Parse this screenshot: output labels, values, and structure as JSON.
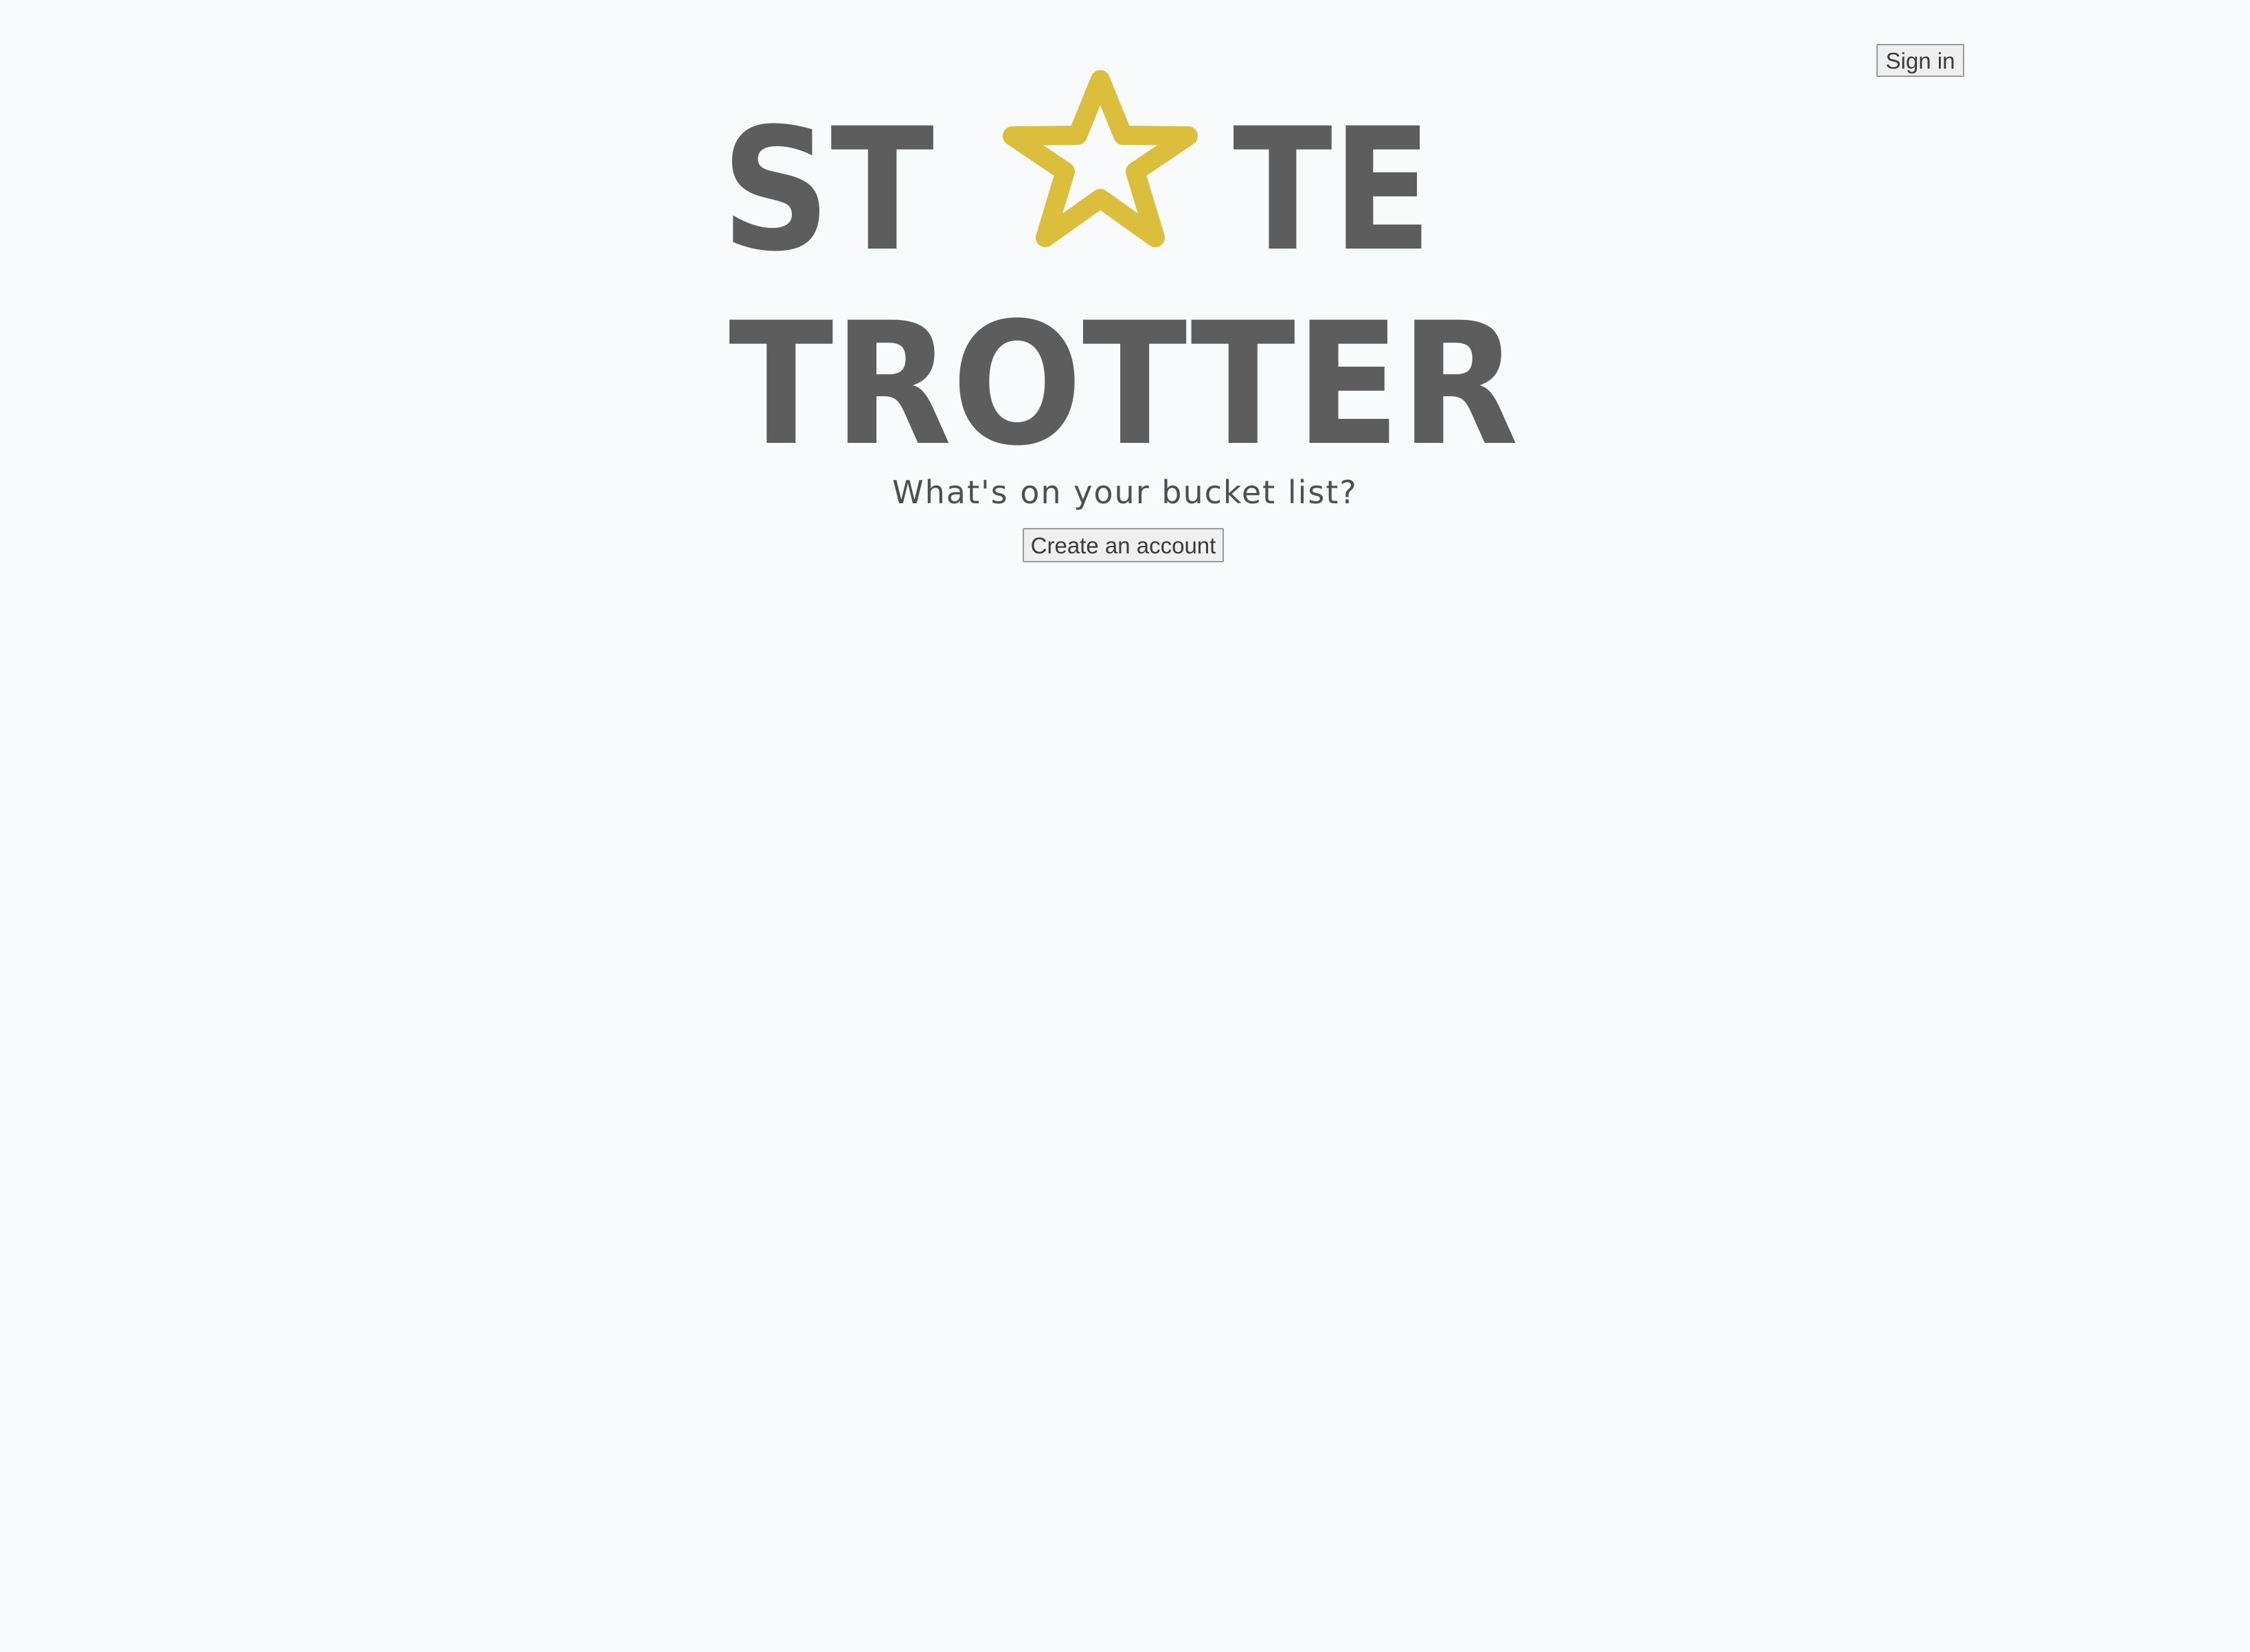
{
  "header": {
    "sign_in_label": "Sign in"
  },
  "logo": {
    "line1_part1": "ST",
    "line1_part2": "TE",
    "line2": "TROTTER",
    "star_icon": "star-icon",
    "text_color": "#5d5d5d",
    "star_color": "#dcbe3d"
  },
  "hero": {
    "tagline": "What's on your bucket list?",
    "create_account_label": "Create an account"
  },
  "colors": {
    "background": "#f9fafb"
  }
}
